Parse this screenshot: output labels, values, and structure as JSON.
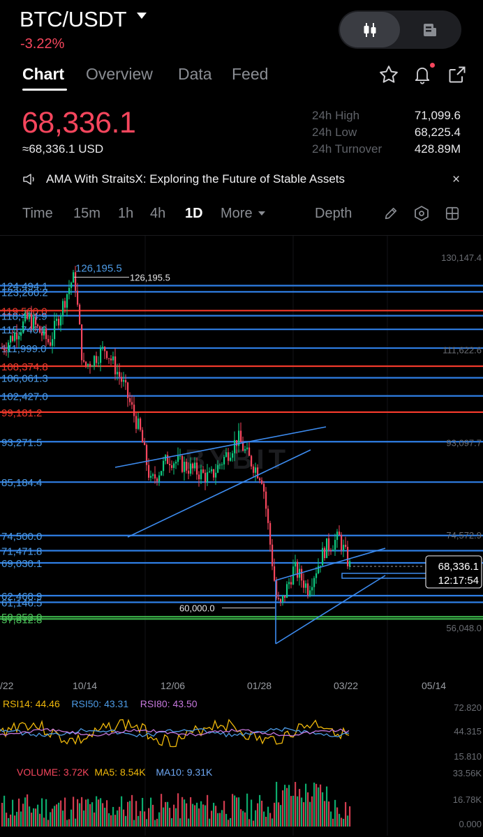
{
  "header": {
    "pair": "BTC/USDT",
    "change_pct": "-3.22%",
    "view_toggle": {
      "active": "candles-icon",
      "other": "document-icon"
    }
  },
  "tabs": [
    {
      "label": "Chart",
      "active": true
    },
    {
      "label": "Overview",
      "active": false
    },
    {
      "label": "Data",
      "active": false
    },
    {
      "label": "Feed",
      "active": false
    }
  ],
  "price": {
    "last": "68,336.1",
    "usd": "≈68,336.1 USD",
    "stats": [
      {
        "label": "24h High",
        "value": "71,099.6"
      },
      {
        "label": "24h Low",
        "value": "68,225.4"
      },
      {
        "label": "24h Turnover",
        "value": "428.89M"
      }
    ]
  },
  "announcement": {
    "text": "AMA With StraitsX: Exploring the Future of Stable Assets",
    "close": "×"
  },
  "timeframes": {
    "items": [
      "Time",
      "15m",
      "1h",
      "4h",
      "1D",
      "More"
    ],
    "active": "1D",
    "depth": "Depth"
  },
  "colors": {
    "up": "#0ecb81",
    "down": "#f6465d",
    "level_blue": "#2f7fe6",
    "level_red": "#f0392b",
    "level_green": "#3cb24a",
    "trend": "#3d8cf0",
    "rsi14": "#f0b90b",
    "rsi50": "#4d9be6",
    "rsi80": "#c678dd",
    "ma5": "#f0b90b",
    "ma10": "#6ea8f4"
  },
  "chart": {
    "watermark": "BYBIT",
    "y_axis": [
      "130,147.4",
      "111,622.6",
      "93,097.7",
      "74,572.9",
      "56,048.0"
    ],
    "x_axis": [
      "/22",
      "10/14",
      "12/06",
      "01/28",
      "03/22",
      "05/14"
    ],
    "current_price": "68,336.1",
    "countdown": "12:17:54",
    "high_marker": "126,195.5",
    "high_marker_right": "126,195.5",
    "low_marker": "60,000.0",
    "levels": [
      {
        "label": "124,494.1",
        "color": "blue"
      },
      {
        "label": "123,260.2",
        "color": "blue"
      },
      {
        "label": "119,500.0",
        "color": "red"
      },
      {
        "label": "118,474.9",
        "color": "blue"
      },
      {
        "label": "115,746.0",
        "color": "blue"
      },
      {
        "label": "111,999.0",
        "color": "blue"
      },
      {
        "label": "108,374.8",
        "color": "red"
      },
      {
        "label": "106,061.3",
        "color": "blue"
      },
      {
        "label": "102,427.0",
        "color": "blue"
      },
      {
        "label": "99,181.2",
        "color": "red"
      },
      {
        "label": "93,271.5",
        "color": "blue"
      },
      {
        "label": "85,184.4",
        "color": "blue"
      },
      {
        "label": "74,500.0",
        "color": "blue"
      },
      {
        "label": "71,471.8",
        "color": "blue"
      },
      {
        "label": "69,030.1",
        "color": "blue"
      },
      {
        "label": "62,468.9",
        "color": "blue"
      },
      {
        "label": "61,146.5",
        "color": "blue"
      },
      {
        "label": "58,252.0",
        "color": "green"
      },
      {
        "label": "57,812.8",
        "color": "green"
      }
    ]
  },
  "rsi": {
    "legend": [
      {
        "label": "RSI14: 44.46",
        "color": "rsi14"
      },
      {
        "label": "RSI50: 43.31",
        "color": "rsi50"
      },
      {
        "label": "RSI80: 43.50",
        "color": "rsi80"
      }
    ],
    "axis": [
      "72.820",
      "44.315",
      "15.810"
    ]
  },
  "volume": {
    "legend": [
      {
        "label": "VOLUME: 3.72K",
        "color": "down"
      },
      {
        "label": "MA5: 8.54K",
        "color": "ma5"
      },
      {
        "label": "MA10: 9.31K",
        "color": "ma10"
      }
    ],
    "axis": [
      "33.56K",
      "16.78K",
      "0.000"
    ]
  }
}
